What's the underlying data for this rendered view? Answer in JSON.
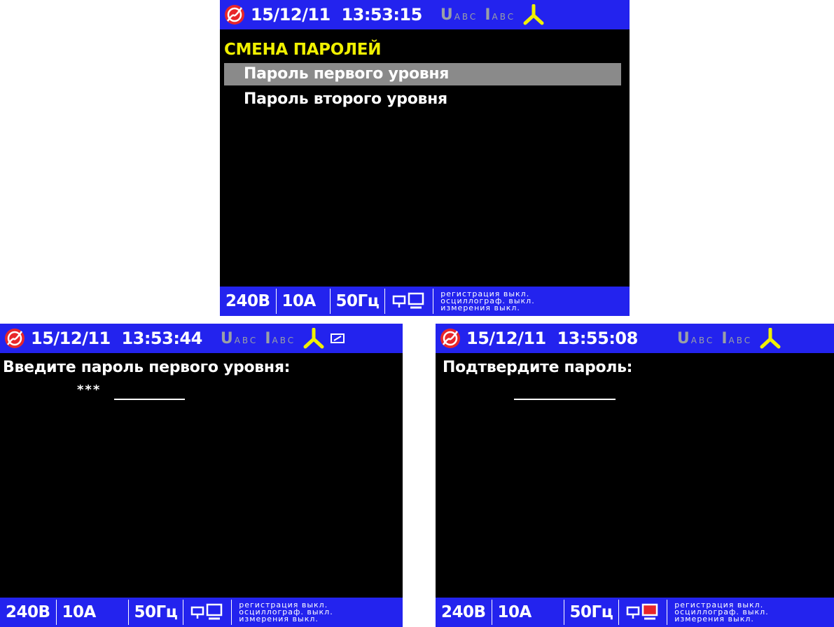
{
  "screens": [
    {
      "datetime": "15/12/11  13:53:15",
      "title": "СМЕНА ПАРОЛЕЙ",
      "menu": [
        "Пароль первого уровня",
        "Пароль второго уровня"
      ]
    },
    {
      "datetime": "15/12/11  13:53:44",
      "prompt": "Введите пароль первого уровня:",
      "entered": "***"
    },
    {
      "datetime": "15/12/11  13:55:08",
      "prompt": "Подтвердите пароль:",
      "entered": ""
    }
  ],
  "indicators": {
    "u": "U",
    "i": "I",
    "phases": "ABC"
  },
  "bottom": {
    "voltage": "240В",
    "current": "10А",
    "frequency": "50Гц",
    "status": [
      "регистрация выкл.",
      "осциллограф. выкл.",
      "измерения выкл."
    ]
  },
  "colors": {
    "bar": "#2323ee",
    "title": "#f0f000",
    "indicator": "#9aa0a6",
    "selection": "#8a8a8a",
    "logo": "#e8262a",
    "alert": "#e8262a"
  },
  "icons": [
    "logo-icon",
    "phase-connection-icon",
    "battery-icon",
    "pc-connection-icon"
  ]
}
